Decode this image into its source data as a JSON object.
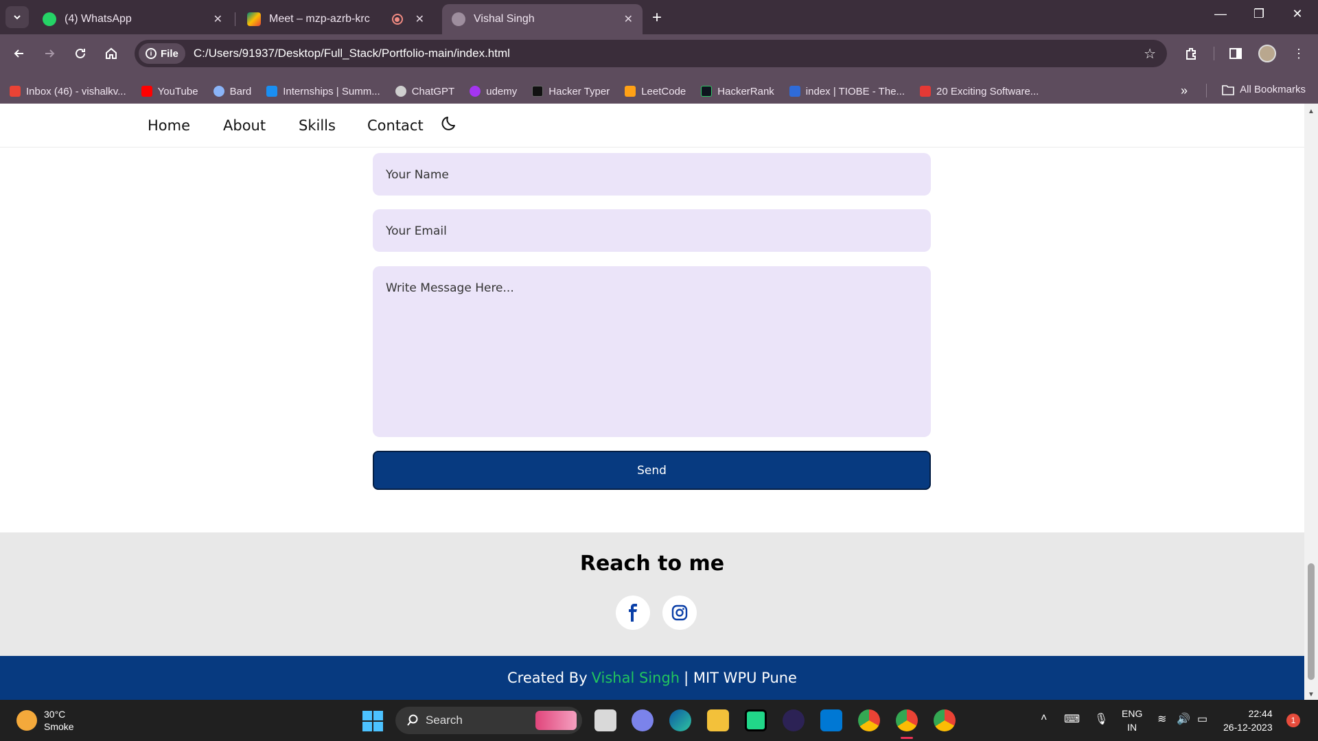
{
  "browser": {
    "tabs": [
      {
        "title": "(4) WhatsApp",
        "icon": "whatsapp-icon",
        "color": "#25d366"
      },
      {
        "title": "Meet – mzp-azrb-krc",
        "icon": "meet-icon",
        "color": "#00897b"
      },
      {
        "title": "Vishal Singh",
        "icon": "globe-icon",
        "color": "#9e8e9e"
      }
    ],
    "address": {
      "chip_label": "File",
      "url": "C:/Users/91937/Desktop/Full_Stack/Portfolio-main/index.html"
    },
    "bookmarks": [
      {
        "label": "Inbox (46) - vishalkv...",
        "icon": "gmail-icon",
        "color": "#ea4335"
      },
      {
        "label": "YouTube",
        "icon": "youtube-icon",
        "color": "#ff0000"
      },
      {
        "label": "Bard",
        "icon": "bard-icon",
        "color": "#8ab4f8"
      },
      {
        "label": "Internships | Summ...",
        "icon": "internshala-icon",
        "color": "#1a8ff2"
      },
      {
        "label": "ChatGPT",
        "icon": "chatgpt-icon",
        "color": "#cfcfcf"
      },
      {
        "label": "udemy",
        "icon": "udemy-icon",
        "color": "#a435f0"
      },
      {
        "label": "Hacker Typer",
        "icon": "terminal-icon",
        "color": "#111111"
      },
      {
        "label": "LeetCode",
        "icon": "leetcode-icon",
        "color": "#ffa116"
      },
      {
        "label": "HackerRank",
        "icon": "hackerrank-icon",
        "color": "#0e141e"
      },
      {
        "label": "index | TIOBE - The...",
        "icon": "tiobe-icon",
        "color": "#2f6bd8"
      },
      {
        "label": "20 Exciting Software...",
        "icon": "bookmark-red-icon",
        "color": "#e53935"
      }
    ],
    "all_bookmarks_label": "All Bookmarks"
  },
  "site": {
    "nav": {
      "home": "Home",
      "about": "About",
      "skills": "Skills",
      "contact": "Contact"
    },
    "form": {
      "name_placeholder": "Your Name",
      "email_placeholder": "Your Email",
      "message_placeholder": "Write Message Here...",
      "send_label": "Send"
    },
    "reach": {
      "title": "Reach to me"
    },
    "footer": {
      "prefix": "Created By",
      "name": "Vishal Singh",
      "suffix": "| MIT WPU Pune"
    }
  },
  "taskbar": {
    "weather": {
      "temp": "30°C",
      "condition": "Smoke"
    },
    "search_label": "Search",
    "lang": {
      "line1": "ENG",
      "line2": "IN"
    },
    "clock": {
      "time": "22:44",
      "date": "26-12-2023"
    },
    "notification_count": "1"
  }
}
